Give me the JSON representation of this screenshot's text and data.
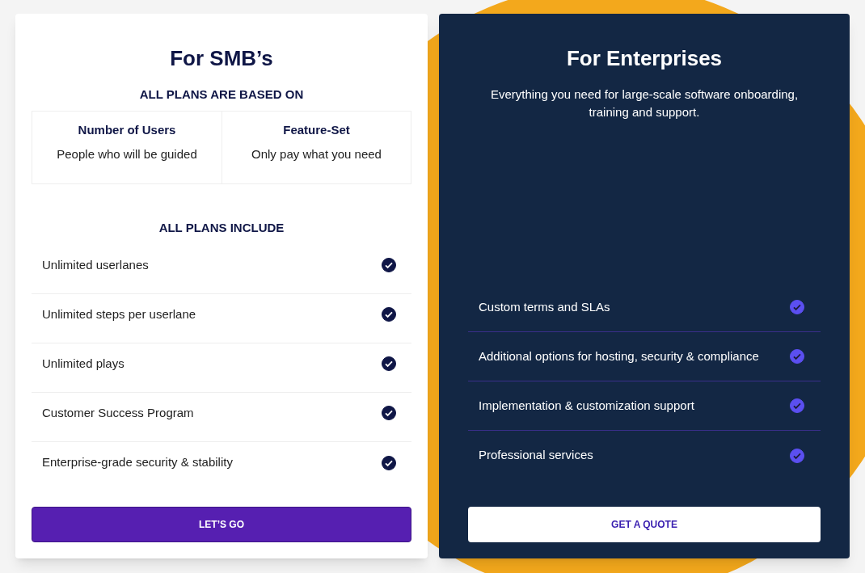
{
  "smb": {
    "title": "For SMB’s",
    "based_on_heading": "ALL PLANS ARE BASED ON",
    "factors": [
      {
        "title": "Number of Users",
        "description": "People who will be guided"
      },
      {
        "title": "Feature-Set",
        "description": "Only pay what you need"
      }
    ],
    "include_heading": "ALL PLANS INCLUDE",
    "features": [
      {
        "label": "Unlimited userlanes",
        "checked": true
      },
      {
        "label": "Unlimited steps per userlane",
        "checked": true
      },
      {
        "label": "Unlimited plays",
        "checked": true
      },
      {
        "label": "Customer Success Program",
        "checked": true
      },
      {
        "label": "Enterprise-grade security & stability",
        "checked": true
      }
    ],
    "button": "LET’S GO"
  },
  "enterprise": {
    "title": "For Enterprises",
    "description": "Everything you need for large-scale software onboarding, training and support.",
    "features": [
      {
        "label": "Custom terms and SLAs",
        "checked": true
      },
      {
        "label": "Additional options for hosting, security & compliance",
        "checked": true
      },
      {
        "label": "Implementation & customization support",
        "checked": true
      },
      {
        "label": "Professional services",
        "checked": true
      }
    ],
    "button": "GET A QUOTE"
  }
}
